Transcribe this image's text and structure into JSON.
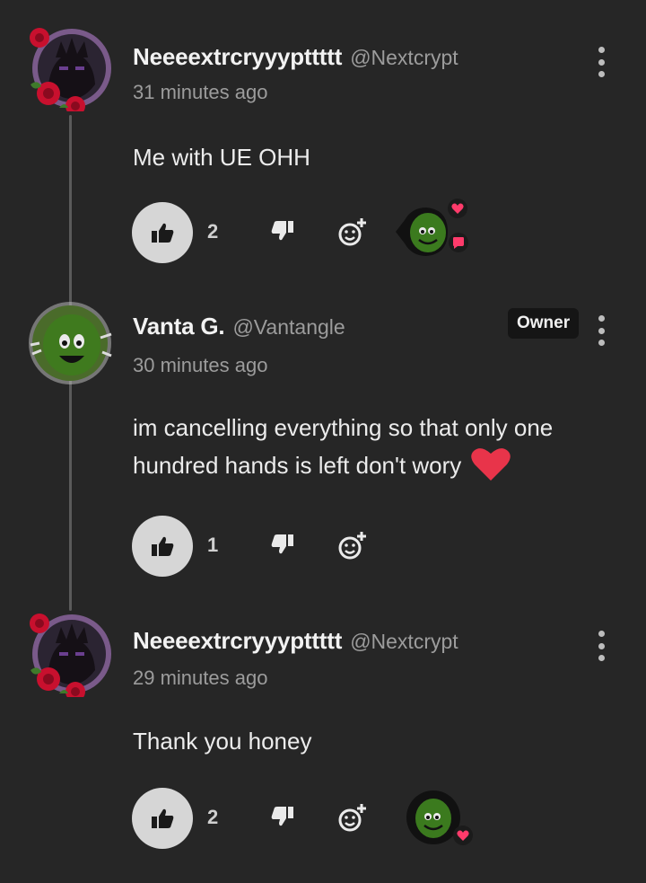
{
  "comments": [
    {
      "author": "Neeeextrcryyypttttt",
      "handle": "@Nextcrypt",
      "time": "31 minutes ago",
      "text": "Me with UE OHH",
      "likes": "2",
      "avatar": "rose-frame-avatar",
      "creator_reaction": {
        "heart": true,
        "reply": true
      }
    },
    {
      "author": "Vanta G.",
      "handle": "@Vantangle",
      "badge": "Owner",
      "time": "30 minutes ago",
      "text": "im cancelling everything so that only one hundred hands is left don't wory",
      "likes": "1",
      "avatar": "green-blob-avatar",
      "emoji": "red-heart"
    },
    {
      "author": "Neeeextrcryyypttttt",
      "handle": "@Nextcrypt",
      "time": "29 minutes ago",
      "text": "Thank you honey",
      "likes": "2",
      "avatar": "rose-frame-avatar",
      "creator_reaction": {
        "heart": true,
        "reply": false
      }
    }
  ],
  "colors": {
    "background": "#262626",
    "like_button": "#d6d6d6",
    "heart": "#e8344a",
    "badge_pink": "#ff3b6b",
    "owner_badge_bg": "#151515"
  }
}
